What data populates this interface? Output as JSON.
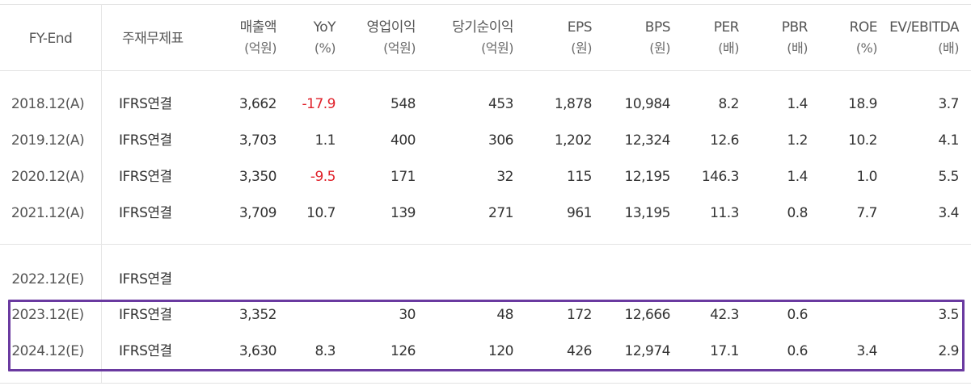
{
  "header": {
    "fy_end": "FY-End",
    "basis": "주재무제표",
    "columns": [
      {
        "top": "매출액",
        "bottom": "(억원)"
      },
      {
        "top": "YoY",
        "bottom": "(%)"
      },
      {
        "top": "영업이익",
        "bottom": "(억원)"
      },
      {
        "top": "당기순이익",
        "bottom": "(억원)"
      },
      {
        "top": "EPS",
        "bottom": "(원)"
      },
      {
        "top": "BPS",
        "bottom": "(원)"
      },
      {
        "top": "PER",
        "bottom": "(배)"
      },
      {
        "top": "PBR",
        "bottom": "(배)"
      },
      {
        "top": "ROE",
        "bottom": "(%)"
      },
      {
        "top": "EV/EBITDA",
        "bottom": "(배)"
      }
    ]
  },
  "rows": [
    {
      "period": "2018.12(A)",
      "basis": "IFRS연결",
      "values": [
        "3,662",
        "-17.9",
        "548",
        "453",
        "1,878",
        "10,984",
        "8.2",
        "1.4",
        "18.9",
        "3.7"
      ]
    },
    {
      "period": "2019.12(A)",
      "basis": "IFRS연결",
      "values": [
        "3,703",
        "1.1",
        "400",
        "306",
        "1,202",
        "12,324",
        "12.6",
        "1.2",
        "10.2",
        "4.1"
      ]
    },
    {
      "period": "2020.12(A)",
      "basis": "IFRS연결",
      "values": [
        "3,350",
        "-9.5",
        "171",
        "32",
        "115",
        "12,195",
        "146.3",
        "1.4",
        "1.0",
        "5.5"
      ]
    },
    {
      "period": "2021.12(A)",
      "basis": "IFRS연결",
      "values": [
        "3,709",
        "10.7",
        "139",
        "271",
        "961",
        "13,195",
        "11.3",
        "0.8",
        "7.7",
        "3.4"
      ]
    },
    {
      "period": "2022.12(E)",
      "basis": "IFRS연결",
      "values": [
        "",
        "",
        "",
        "",
        "",
        "",
        "",
        "",
        "",
        ""
      ]
    },
    {
      "period": "2023.12(E)",
      "basis": "IFRS연결",
      "values": [
        "3,352",
        "",
        "30",
        "48",
        "172",
        "12,666",
        "42.3",
        "0.6",
        "",
        "3.5"
      ]
    },
    {
      "period": "2024.12(E)",
      "basis": "IFRS연결",
      "values": [
        "3,630",
        "8.3",
        "126",
        "120",
        "426",
        "12,974",
        "17.1",
        "0.6",
        "3.4",
        "2.9"
      ]
    }
  ],
  "colors": {
    "negative": "#e0222b",
    "highlight_border": "#6a3aa0",
    "grid_line": "#e3e3e3"
  }
}
